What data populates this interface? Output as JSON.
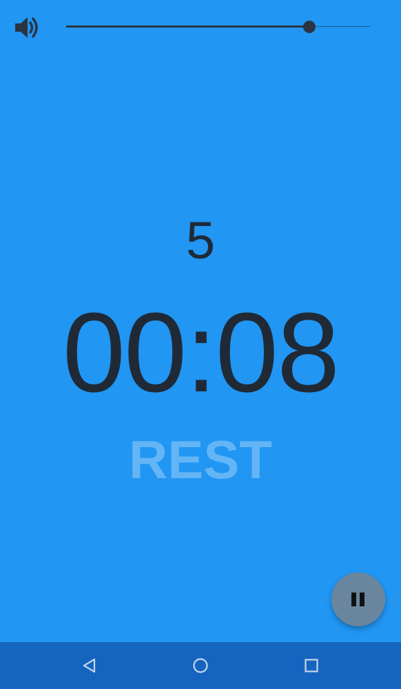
{
  "volume": {
    "icon": "volume-up-icon",
    "level_percent": 80
  },
  "workout": {
    "round": "5",
    "time": "00:08",
    "phase": "REST"
  },
  "controls": {
    "pause_icon": "pause-icon"
  },
  "navbar": {
    "back_icon": "back-triangle-icon",
    "home_icon": "home-circle-icon",
    "recents_icon": "recents-square-icon"
  },
  "colors": {
    "background": "#2196F3",
    "text": "#1f2a36",
    "phase_text": "#64B5F6",
    "fab": "#6A869E",
    "navbar": "#1565C0"
  }
}
